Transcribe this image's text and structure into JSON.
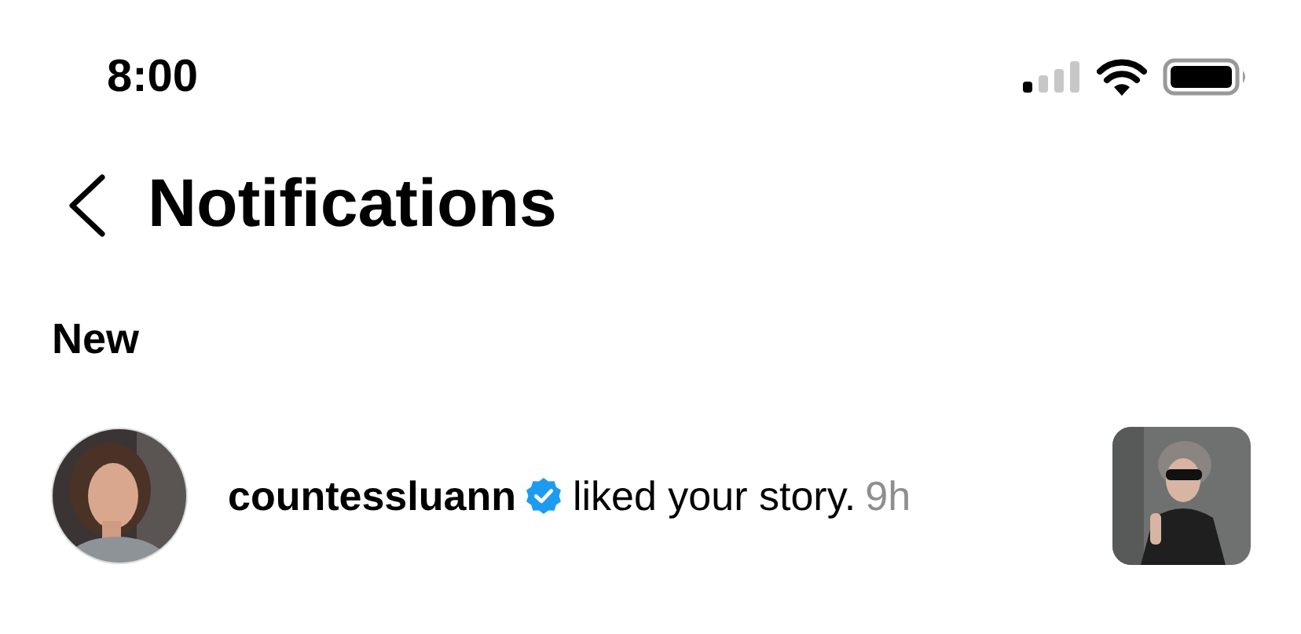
{
  "status_bar": {
    "time": "8:00"
  },
  "header": {
    "title": "Notifications"
  },
  "sections": [
    {
      "title": "New",
      "notifications": [
        {
          "username": "countessluann",
          "verified": true,
          "action": "liked your story.",
          "time": "9h"
        }
      ]
    }
  ]
}
